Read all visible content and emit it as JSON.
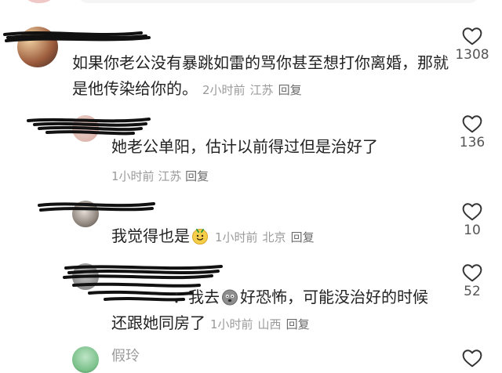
{
  "comments": [
    {
      "text": "如果你老公没有暴跳如雷的骂你甚至想打你离婚，那就是他传染给你的。",
      "time": "2小时前",
      "location": "江苏",
      "reply": "回复",
      "likes": "1308"
    },
    {
      "text": "她老公单阳，估计以前得过但是治好了",
      "time": "1小时前",
      "location": "江苏",
      "reply": "回复",
      "likes": "136"
    },
    {
      "text": "我觉得也是",
      "emoji": "smile-face-emoji",
      "time": "1小时前",
      "location": "北京",
      "reply": "回复",
      "likes": "10"
    },
    {
      "prefix": "：",
      "text_a": "我去",
      "emoji": "gray-face-emoji",
      "text_b": "好恐怖，可能没治好的时候",
      "text_c": "还跟她同房了",
      "time": "1小时前",
      "location": "山西",
      "reply": "回复",
      "likes": "52"
    },
    {
      "username": "假玲"
    }
  ],
  "colors": {
    "text": "#222222",
    "meta": "#9a9a9a",
    "heart_stroke": "#333333"
  }
}
